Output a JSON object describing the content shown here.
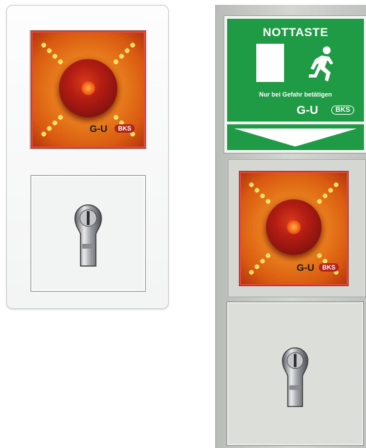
{
  "sign": {
    "title": "NOTTASTE",
    "subtitle": "Nur bei Gefahr betätigen",
    "brand_gu": "G-U",
    "brand_bks": "BKS",
    "color": "#1f9a45"
  },
  "left_unit": {
    "brand_gu": "G-U",
    "brand_bks": "BKS"
  },
  "right_unit": {
    "brand_gu": "G-U",
    "brand_bks": "BKS"
  },
  "icons": [
    "emergency-exit-runner-icon",
    "door-icon",
    "arrow-down-icon",
    "key-cylinder-icon",
    "emergency-stop-button-icon"
  ]
}
